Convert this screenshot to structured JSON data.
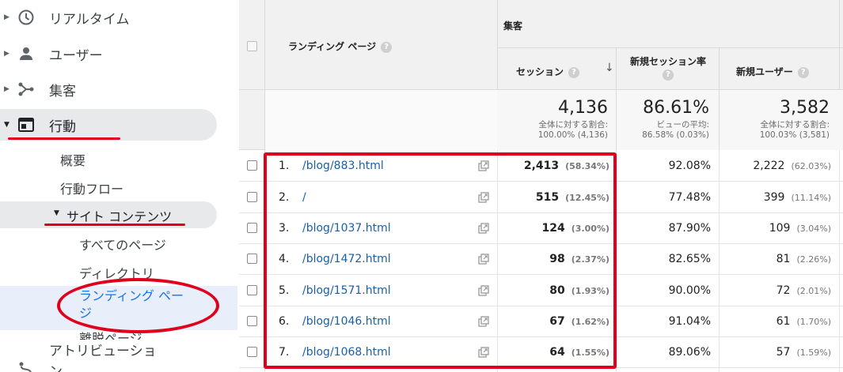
{
  "sidebar": {
    "top_items": [
      {
        "label": "リアルタイム",
        "icon": "clock-icon"
      },
      {
        "label": "ユーザー",
        "icon": "person-icon"
      },
      {
        "label": "集客",
        "icon": "acquisition-icon"
      },
      {
        "label": "行動",
        "icon": "behavior-icon"
      }
    ],
    "behavior_children": [
      "概要",
      "行動フロー"
    ],
    "site_content_label": "サイト コンテンツ",
    "site_content_children": [
      "すべてのページ",
      "ディレクトリ",
      "ランディング ページ",
      "離脱ページ"
    ],
    "attribution_label": "アトリビューション"
  },
  "table": {
    "header": {
      "landing_page": "ランディング ページ",
      "acquisition": "集客",
      "sessions": "セッション",
      "new_session_rate": "新規セッション率",
      "new_users": "新規ユーザー",
      "help_glyph": "?",
      "sort_glyph": "↓"
    },
    "totals": {
      "sessions": {
        "value": "4,136",
        "line1": "全体に対する割合:",
        "line2": "100.00% (4,136)"
      },
      "new_session_rate": {
        "value": "86.61%",
        "line1": "ビューの平均:",
        "line2": "86.58% (0.03%)"
      },
      "new_users": {
        "value": "3,582",
        "line1": "全体に対する割合:",
        "line2": "100.03% (3,581)"
      }
    },
    "rows": [
      {
        "num": "1.",
        "page": "/blog/883.html",
        "sessions": "2,413",
        "sessions_pct": "(58.34%)",
        "rate": "92.08%",
        "new_users": "2,222",
        "new_users_pct": "(62.03%)"
      },
      {
        "num": "2.",
        "page": "/",
        "sessions": "515",
        "sessions_pct": "(12.45%)",
        "rate": "77.48%",
        "new_users": "399",
        "new_users_pct": "(11.14%)"
      },
      {
        "num": "3.",
        "page": "/blog/1037.html",
        "sessions": "124",
        "sessions_pct": "(3.00%)",
        "rate": "87.90%",
        "new_users": "109",
        "new_users_pct": "(3.04%)"
      },
      {
        "num": "4.",
        "page": "/blog/1472.html",
        "sessions": "98",
        "sessions_pct": "(2.37%)",
        "rate": "82.65%",
        "new_users": "81",
        "new_users_pct": "(2.26%)"
      },
      {
        "num": "5.",
        "page": "/blog/1571.html",
        "sessions": "80",
        "sessions_pct": "(1.93%)",
        "rate": "90.00%",
        "new_users": "72",
        "new_users_pct": "(2.01%)"
      },
      {
        "num": "6.",
        "page": "/blog/1046.html",
        "sessions": "67",
        "sessions_pct": "(1.62%)",
        "rate": "91.04%",
        "new_users": "61",
        "new_users_pct": "(1.70%)"
      },
      {
        "num": "7.",
        "page": "/blog/1068.html",
        "sessions": "64",
        "sessions_pct": "(1.55%)",
        "rate": "89.06%",
        "new_users": "57",
        "new_users_pct": "(1.59%)"
      }
    ]
  },
  "colors": {
    "annotation_red": "#e0001b",
    "link_blue": "#1a5fa8",
    "selected_blue": "#1a73e8",
    "nav_active_bg": "#e8e9eb",
    "header_bg": "#f1f1f1"
  }
}
